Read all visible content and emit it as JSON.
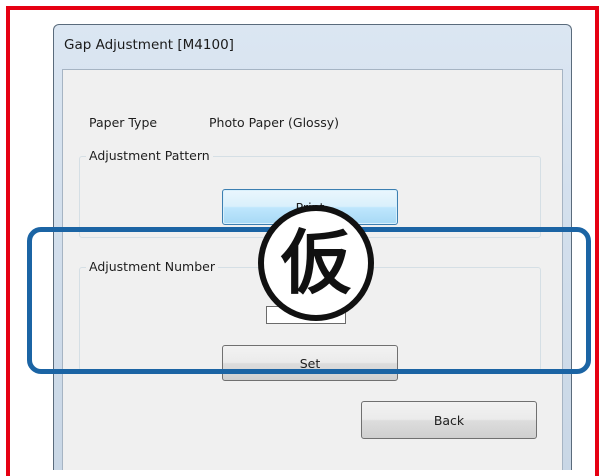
{
  "window": {
    "title": "Gap Adjustment [M4100]"
  },
  "paper": {
    "label": "Paper Type",
    "value": "Photo Paper (Glossy)"
  },
  "pattern_group": {
    "legend": "Adjustment Pattern",
    "print_label": "Print"
  },
  "number_group": {
    "legend": "Adjustment Number",
    "value": "",
    "set_label": "Set"
  },
  "footer": {
    "back_label": "Back"
  },
  "overlay": {
    "stamp_text": "仮"
  },
  "colors": {
    "outer_frame": "#e60012",
    "highlight_frame": "#1b64a4",
    "focused_button": "#bee6fd"
  }
}
